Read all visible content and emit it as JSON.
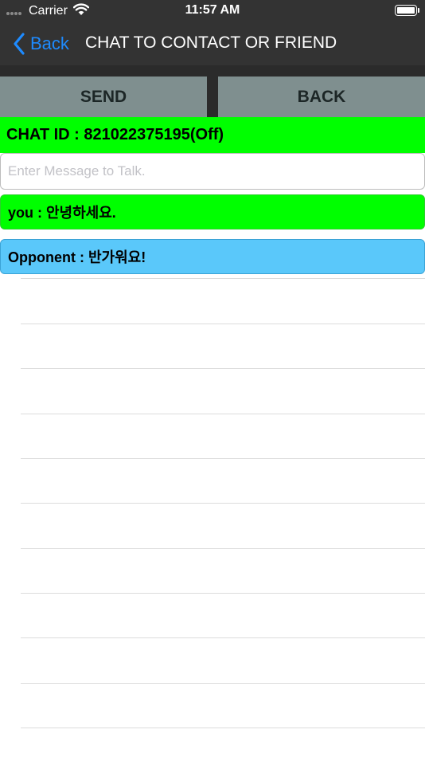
{
  "status_bar": {
    "carrier": "Carrier",
    "time": "11:57 AM"
  },
  "nav": {
    "back_label": "Back",
    "title": "CHAT TO CONTACT OR FRIEND"
  },
  "actions": {
    "send_label": "SEND",
    "back_label": "BACK"
  },
  "chat": {
    "id_text": "CHAT ID : 821022375195(Off)"
  },
  "input": {
    "value": "",
    "placeholder": "Enter Message to Talk."
  },
  "messages": [
    {
      "text": "you : 안녕하세요.",
      "color": "#00ff00"
    },
    {
      "text": "Opponent : 반가워요!",
      "color": "#5ac8fa"
    }
  ],
  "colors": {
    "bar_background": "#333333",
    "accent": "#1e8bff",
    "button": "#7f8f8f",
    "chat_id_bar": "#00ff00"
  }
}
